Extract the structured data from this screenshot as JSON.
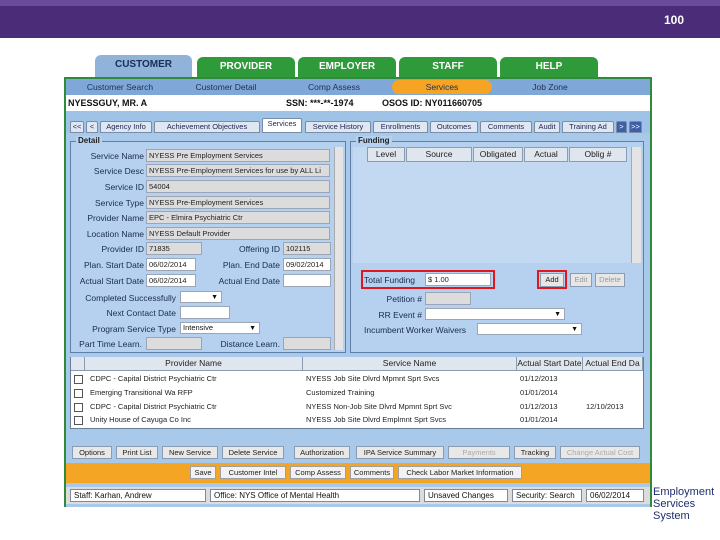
{
  "slide": {
    "number": "100"
  },
  "main_tabs": [
    {
      "label": "CUSTOMER"
    },
    {
      "label": "PROVIDER"
    },
    {
      "label": "EMPLOYER"
    },
    {
      "label": "STAFF"
    },
    {
      "label": "HELP"
    }
  ],
  "sub_nav": [
    {
      "label": "Customer Search"
    },
    {
      "label": "Customer Detail"
    },
    {
      "label": "Comp Assess"
    },
    {
      "label": "Services"
    },
    {
      "label": "Job Zone"
    }
  ],
  "customer": {
    "name": "NYESSGUY, MR. A",
    "ssn": "SSN: ***-**-1974",
    "osos_id": "OSOS ID: NY011660705"
  },
  "panel_tabs": [
    {
      "label": "<<"
    },
    {
      "label": "<"
    },
    {
      "label": "Agency Info"
    },
    {
      "label": "Achievement Objectives"
    },
    {
      "label": "Services"
    },
    {
      "label": "Service History"
    },
    {
      "label": "Enrollments"
    },
    {
      "label": "Outcomes"
    },
    {
      "label": "Comments"
    },
    {
      "label": "Audit"
    },
    {
      "label": "Training Ad"
    },
    {
      "label": ">"
    },
    {
      "label": ">>"
    }
  ],
  "detail": {
    "title": "Detail",
    "service_name_label": "Service Name",
    "service_name": "NYESS Pre Employment Services",
    "service_desc_label": "Service Desc",
    "service_desc": "NYESS Pre-Employment Services for use by ALL Li",
    "service_id_label": "Service ID",
    "service_id": "54004",
    "service_type_label": "Service Type",
    "service_type": "NYESS Pre-Employment Services",
    "provider_name_label": "Provider Name",
    "provider_name": "EPC - Elmira Psychiatric Ctr",
    "location_name_label": "Location Name",
    "location_name": "NYESS Default Provider",
    "provider_id_label": "Provider ID",
    "provider_id": "71835",
    "offering_id_label": "Offering ID",
    "offering_id": "102115",
    "plan_start_label": "Plan. Start Date",
    "plan_start": "06/02/2014",
    "plan_end_label": "Plan. End Date",
    "plan_end": "09/02/2014",
    "actual_start_label": "Actual Start Date",
    "actual_start": "06/02/2014",
    "actual_end_label": "Actual End Date",
    "actual_end": "",
    "completed_label": "Completed Successfully",
    "next_contact_label": "Next Contact Date",
    "program_service_type_label": "Program Service Type",
    "program_service_type": "Intensive",
    "part_time_label": "Part Time Learn.",
    "distance_label": "Distance Learn."
  },
  "funding": {
    "title": "Funding",
    "columns": [
      "Level",
      "Source",
      "Obligated",
      "Actual",
      "Oblig #"
    ],
    "total_funding_label": "Total Funding",
    "total_funding": "$ 1.00",
    "add_label": "Add",
    "edit_label": "Edit",
    "delete_label": "Delete",
    "petition_label": "Petition #",
    "rr_event_label": "RR Event #",
    "incumbent_label": "Incumbent Worker Waivers"
  },
  "grid": {
    "columns": [
      "Provider Name",
      "Service Name",
      "Actual Start Date",
      "Actual End Da"
    ],
    "rows": [
      {
        "provider": "CDPC - Capital District Psychiatric Ctr",
        "service": "NYESS Job Site Dlvrd Mpmnt Sprt Svcs",
        "start": "01/12/2013",
        "end": ""
      },
      {
        "provider": "Emerging Transitional Wa RFP",
        "service": "Customized Training",
        "start": "01/01/2014",
        "end": ""
      },
      {
        "provider": "CDPC - Capital District Psychiatric Ctr",
        "service": "NYESS Non-Job Site Dlvrd Mpmnt Sprt Svc",
        "start": "01/12/2013",
        "end": "12/10/2013"
      },
      {
        "provider": "Unity House of Cayuga Co Inc",
        "service": "NYESS Job Site Dlvrd Emplmnt Sprt Svcs",
        "start": "01/01/2014",
        "end": ""
      }
    ]
  },
  "grid_buttons": [
    {
      "label": "Options",
      "disabled": false
    },
    {
      "label": "Print List",
      "disabled": false
    },
    {
      "label": "New Service",
      "disabled": false
    },
    {
      "label": "Delete Service",
      "disabled": false
    },
    {
      "label": "Authorization",
      "disabled": false
    },
    {
      "label": "IPA Service Summary",
      "disabled": false
    },
    {
      "label": "Payments",
      "disabled": true
    },
    {
      "label": "Tracking",
      "disabled": false
    },
    {
      "label": "Change Actual Cost",
      "disabled": true
    }
  ],
  "action_buttons": [
    {
      "label": "Save"
    },
    {
      "label": "Customer Intel"
    },
    {
      "label": "Comp Assess"
    },
    {
      "label": "Comments"
    },
    {
      "label": "Check Labor Market Information"
    }
  ],
  "status": {
    "staff": "Staff: Karhan, Andrew",
    "office": "Office: NYS Office of Mental Health",
    "unsaved": "Unsaved Changes",
    "security": "Security: Search",
    "date": "06/02/2014"
  },
  "logo": {
    "line1": "Employment",
    "line2": "Services System"
  }
}
